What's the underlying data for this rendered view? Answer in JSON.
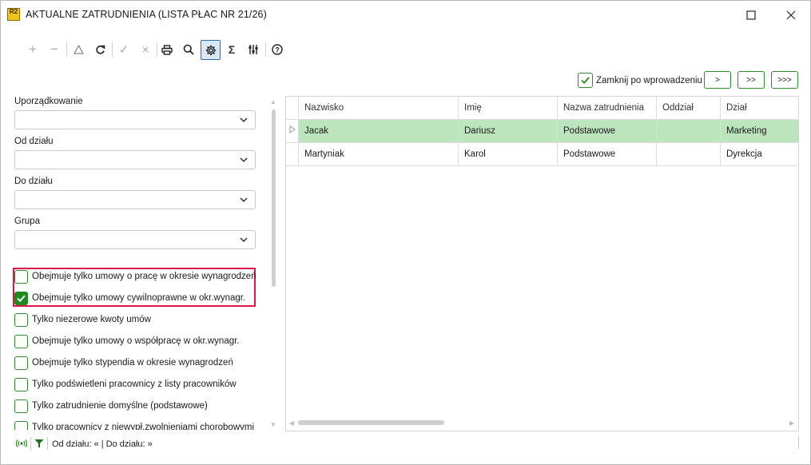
{
  "window": {
    "app_logo": "R2",
    "title": "AKTUALNE ZATRUDNIENIA (LISTA PŁAC NR 21/26)",
    "maximize_icon": "maximize-icon",
    "close_icon": "close-icon"
  },
  "toolbar": {
    "items": [
      {
        "name": "add",
        "glyph": "+",
        "icon": "plus-icon",
        "enabled": false
      },
      {
        "name": "remove",
        "glyph": "−",
        "icon": "minus-icon",
        "enabled": false
      },
      {
        "name": "edit",
        "glyph": "△",
        "icon": "triangle-icon",
        "enabled": false
      },
      {
        "name": "refresh",
        "glyph": "↻",
        "icon": "refresh-icon",
        "enabled": true
      },
      {
        "name": "accept",
        "glyph": "✓",
        "icon": "check-icon",
        "enabled": false
      },
      {
        "name": "cancel",
        "glyph": "×",
        "icon": "cancel-icon",
        "enabled": false
      },
      {
        "name": "print",
        "glyph": "⎙",
        "icon": "print-icon",
        "enabled": true
      },
      {
        "name": "search",
        "glyph": "⌕",
        "icon": "search-icon",
        "enabled": true
      },
      {
        "name": "settings",
        "glyph": "⚙",
        "icon": "gear-icon",
        "enabled": true,
        "active": true
      },
      {
        "name": "sum",
        "glyph": "Σ",
        "icon": "sigma-icon",
        "enabled": true
      },
      {
        "name": "filters",
        "glyph": "⫶",
        "icon": "sliders-icon",
        "enabled": true
      },
      {
        "name": "help",
        "glyph": "?",
        "icon": "help-icon",
        "enabled": true
      }
    ]
  },
  "filters": {
    "sort_label": "Uporządkowanie",
    "sort_value": "",
    "from_dept_label": "Od działu",
    "from_dept_value": "",
    "to_dept_label": "Do działu",
    "to_dept_value": "",
    "group_label": "Grupa",
    "group_value": "",
    "checkboxes": [
      {
        "label": "Obejmuje tylko umowy o pracę w okresie wynagrodzeń",
        "checked": false
      },
      {
        "label": "Obejmuje tylko umowy cywilnoprawne w okr.wynagr.",
        "checked": true
      },
      {
        "label": "Tylko niezerowe kwoty umów",
        "checked": false
      },
      {
        "label": "Obejmuje tylko umowy o współpracę w okr.wynagr.",
        "checked": false
      },
      {
        "label": "Obejmuje tylko stypendia w okresie wynagrodzeń",
        "checked": false
      },
      {
        "label": "Tylko podświetleni pracownicy z listy pracowników",
        "checked": false
      },
      {
        "label": "Tylko zatrudnienie domyślne (podstawowe)",
        "checked": false
      },
      {
        "label": "Tylko pracownicy z niewypł.zwolnieniami chorobowymi",
        "checked": false
      }
    ]
  },
  "status": {
    "text": "Od działu: « | Do działu: »",
    "broadcast_icon": "broadcast-icon",
    "filter_icon": "funnel-icon"
  },
  "actions": {
    "close_after_label": "Zamknij po wprowadzeniu",
    "close_after_checked": true,
    "nav_buttons": [
      ">",
      ">>",
      ">>>"
    ]
  },
  "grid": {
    "columns": [
      "Nazwisko",
      "Imię",
      "Nazwa zatrudnienia",
      "Oddział",
      "Dział"
    ],
    "rows": [
      {
        "cells": [
          "Jacak",
          "Dariusz",
          "Podstawowe",
          "",
          "Marketing"
        ],
        "selected": true
      },
      {
        "cells": [
          "Martyniak",
          "Karol",
          "Podstawowe",
          "",
          "Dyrekcja"
        ],
        "selected": false
      }
    ]
  },
  "colors": {
    "accent_green": "#1f8a1f",
    "selected_row": "#bde5bd",
    "highlight_border": "#e0144c"
  }
}
